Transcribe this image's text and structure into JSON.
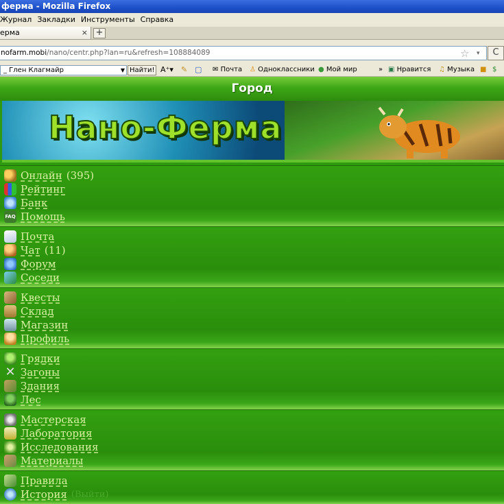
{
  "window": {
    "title": "ферма - Mozilla Firefox"
  },
  "menu": [
    "Журнал",
    "Закладки",
    "Инструменты",
    "Справка"
  ],
  "tab": {
    "title": "ерма",
    "close": "×",
    "new_tab": "+"
  },
  "address": {
    "host": "nofarm.mobi",
    "path": "/nano/centr.php?lan=ru&refresh=108884089",
    "star": "☆",
    "dropdown": "▾",
    "reload": "C"
  },
  "toolbar": {
    "search_value": "_ Глен Клагмайр",
    "find_button": "Найти!",
    "items": [
      "Почта",
      "Одноклассники",
      "Мой мир",
      "»",
      "Нравится",
      "Музыка"
    ]
  },
  "page": {
    "header": "Город",
    "banner_logo": "Нано-Ферма"
  },
  "sections": [
    {
      "items": [
        {
          "label": "Онлайн",
          "count": "(395)",
          "icon": "people-icon",
          "color": "#c9a02a"
        },
        {
          "label": "Рейтинг",
          "icon": "bar-chart-icon",
          "color": "#e0a030"
        },
        {
          "label": "Банк",
          "icon": "bank-icon",
          "color": "#5aa0e0"
        },
        {
          "label": "Помощь",
          "icon": "faq-icon",
          "color": "#3d8c2a"
        }
      ]
    },
    {
      "items": [
        {
          "label": "Почта",
          "icon": "envelope-icon",
          "color": "#d9e3f2"
        },
        {
          "label": "Чат",
          "count": "(11)",
          "icon": "chat-people-icon",
          "color": "#d08a3a"
        },
        {
          "label": "Форум",
          "icon": "forum-icon",
          "color": "#4a90d9"
        },
        {
          "label": "Соседи",
          "icon": "neighbors-icon",
          "color": "#4aa0c0"
        }
      ]
    },
    {
      "items": [
        {
          "label": "Квесты",
          "icon": "scroll-icon",
          "color": "#a07840"
        },
        {
          "label": "Склад",
          "icon": "crate-icon",
          "color": "#c09a50"
        },
        {
          "label": "Магазин",
          "icon": "cart-icon",
          "color": "#a0c0d0"
        },
        {
          "label": "Профиль",
          "icon": "farmer-icon",
          "color": "#e0b040"
        }
      ]
    },
    {
      "items": [
        {
          "label": "Грядки",
          "icon": "sprout-icon",
          "color": "#6ac040"
        },
        {
          "label": "Загоны",
          "icon": "tools-icon",
          "color": "#b0b0b0"
        },
        {
          "label": "Здания",
          "icon": "building-icon",
          "color": "#a08050"
        },
        {
          "label": "Лес",
          "icon": "tree-icon",
          "color": "#3a9030"
        }
      ]
    },
    {
      "items": [
        {
          "label": "Мастерская",
          "icon": "gears-icon",
          "color": "#c0c0c0"
        },
        {
          "label": "Лаборатория",
          "icon": "flask-icon",
          "color": "#e0d070"
        },
        {
          "label": "Исследования",
          "icon": "research-icon",
          "color": "#70c040"
        },
        {
          "label": "Материалы",
          "icon": "materials-icon",
          "color": "#b08060"
        }
      ]
    },
    {
      "items": [
        {
          "label": "Правила",
          "icon": "book-icon",
          "color": "#70a040"
        },
        {
          "label": "История",
          "extra": "(Выйти)",
          "icon": "globe-icon",
          "color": "#5aa0e0"
        }
      ]
    }
  ]
}
